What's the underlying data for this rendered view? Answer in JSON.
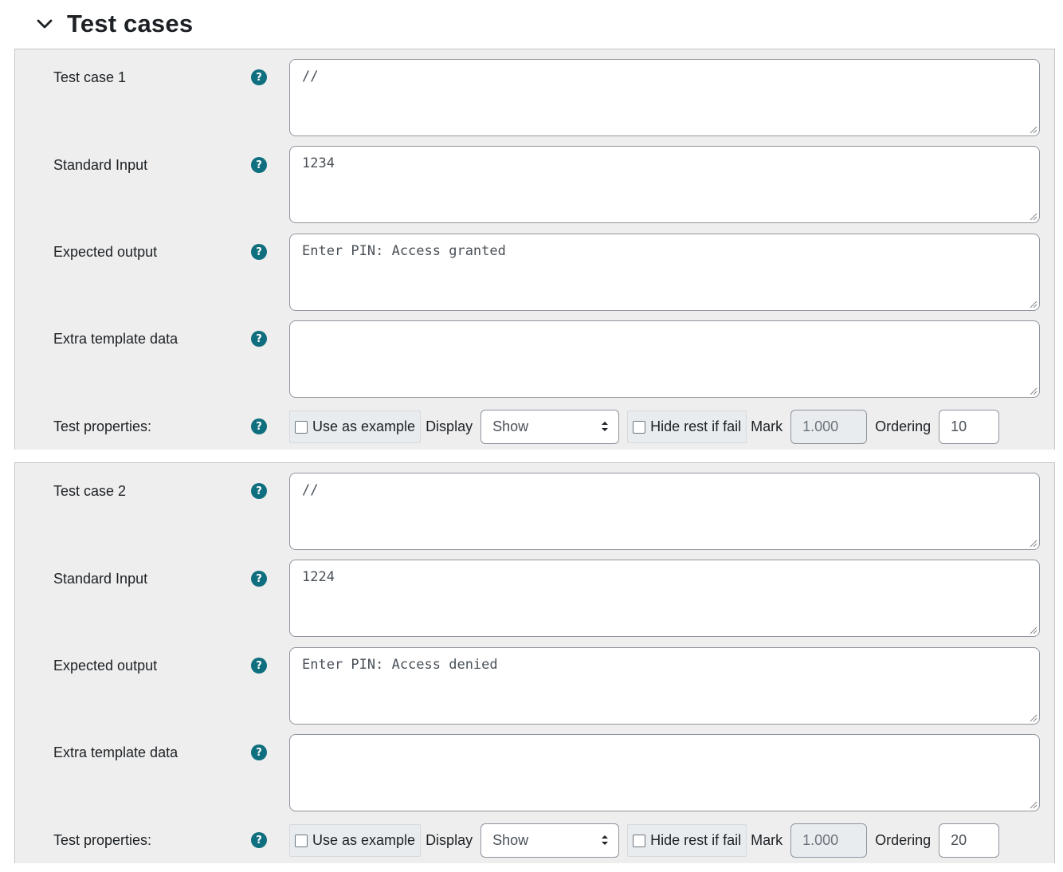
{
  "section": {
    "title": "Test cases",
    "toggle_icon": "chevron-down-icon"
  },
  "labels": {
    "standard_input": "Standard Input",
    "expected_output": "Expected output",
    "extra_template_data": "Extra template data",
    "test_properties": "Test properties:",
    "use_as_example": "Use as example",
    "display": "Display",
    "hide_rest_if_fail": "Hide rest if fail",
    "mark": "Mark",
    "ordering": "Ordering",
    "help_glyph": "?"
  },
  "colors": {
    "help_icon": "#0f6f7f",
    "panel_background": "#eeeeee"
  },
  "testcases": [
    {
      "label": "Test case 1",
      "code": "//",
      "standard_input": "1234",
      "expected_output": "Enter PIN: Access granted",
      "extra_template_data": "",
      "use_as_example": false,
      "display": "Show",
      "hide_rest_if_fail": false,
      "mark": "1.000",
      "ordering": "10"
    },
    {
      "label": "Test case 2",
      "code": "//",
      "standard_input": "1224",
      "expected_output": "Enter PIN: Access denied",
      "extra_template_data": "",
      "use_as_example": false,
      "display": "Show",
      "hide_rest_if_fail": false,
      "mark": "1.000",
      "ordering": "20"
    }
  ]
}
